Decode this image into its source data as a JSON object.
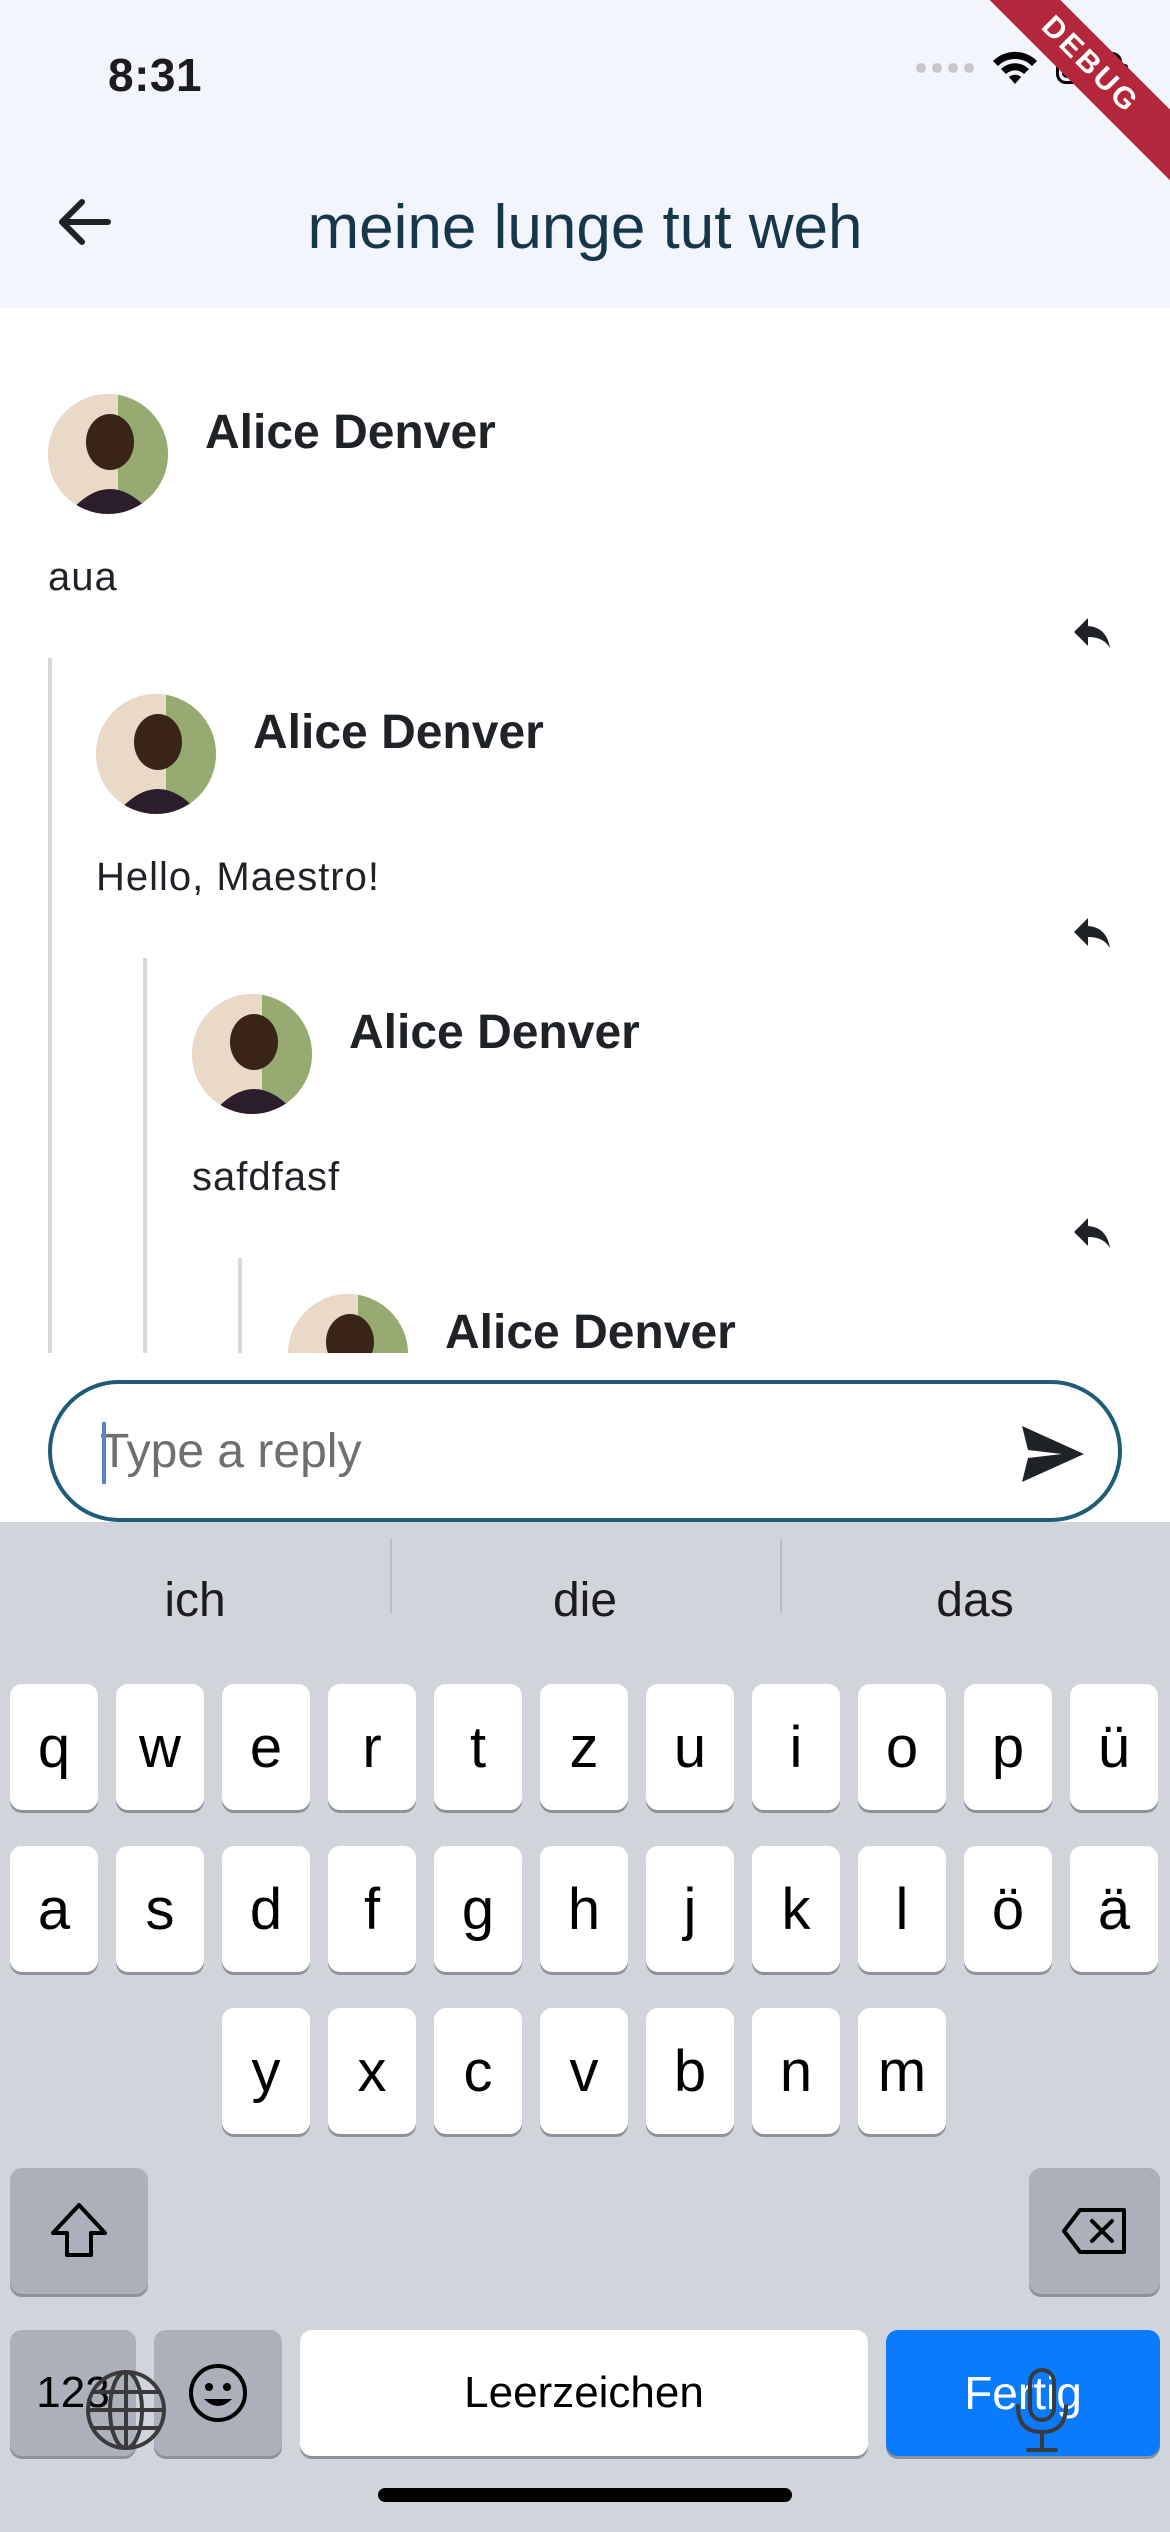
{
  "status_bar": {
    "time": "8:31",
    "debug_label": "DEBUG"
  },
  "header": {
    "title": "meine lunge tut weh"
  },
  "comments": [
    {
      "author": "Alice Denver",
      "text": "aua"
    },
    {
      "author": "Alice Denver",
      "text": "Hello, Maestro!"
    },
    {
      "author": "Alice Denver",
      "text": "safdfasf"
    },
    {
      "author": "Alice Denver",
      "text": ""
    }
  ],
  "reply_box": {
    "placeholder": "Type a reply",
    "value": ""
  },
  "keyboard": {
    "suggestions": [
      "ich",
      "die",
      "das"
    ],
    "row1": [
      "q",
      "w",
      "e",
      "r",
      "t",
      "z",
      "u",
      "i",
      "o",
      "p",
      "ü"
    ],
    "row2": [
      "a",
      "s",
      "d",
      "f",
      "g",
      "h",
      "j",
      "k",
      "l",
      "ö",
      "ä"
    ],
    "row3": [
      "y",
      "x",
      "c",
      "v",
      "b",
      "n",
      "m"
    ],
    "numbers_label": "123",
    "space_label": "Leerzeichen",
    "done_label": "Fertig"
  },
  "colors": {
    "accent": "#1d5d78",
    "keyboard_done": "#0a7aff",
    "app_bar": "#f2f5fb"
  }
}
